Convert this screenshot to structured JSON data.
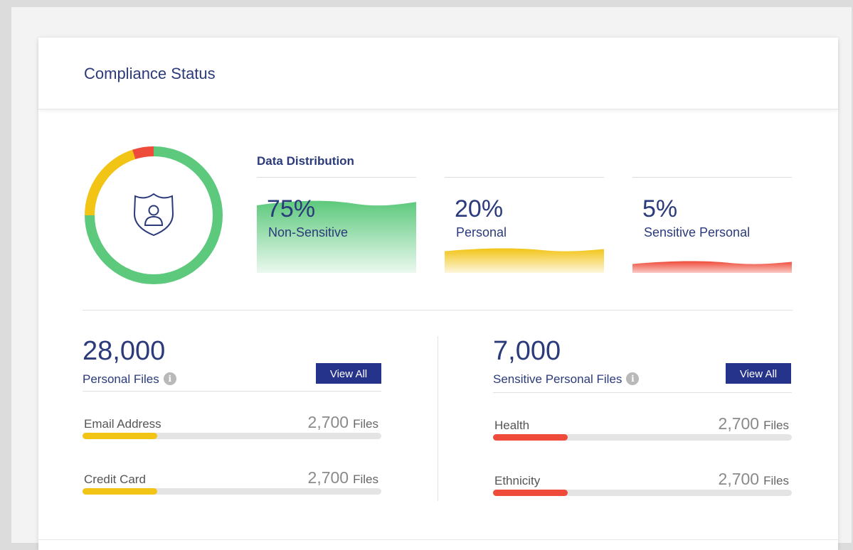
{
  "card": {
    "title": "Compliance Status"
  },
  "colors": {
    "green": "#5cc97c",
    "yellow": "#f2c416",
    "red": "#ef4b3a",
    "navy": "#2b3a7a",
    "button": "#26338a"
  },
  "donut": {
    "icon": "shield-user-icon",
    "segments": [
      {
        "name": "Non-Sensitive",
        "value": 75,
        "color": "#5cc97c"
      },
      {
        "name": "Personal",
        "value": 20,
        "color": "#f2c416"
      },
      {
        "name": "Sensitive Personal",
        "value": 5,
        "color": "#ef4b3a"
      }
    ]
  },
  "distribution": {
    "title": "Data Distribution",
    "items": [
      {
        "percent": "75%",
        "label": "Non-Sensitive",
        "value": 75,
        "color": "#5cc97c"
      },
      {
        "percent": "20%",
        "label": "Personal",
        "value": 20,
        "color": "#f2c416"
      },
      {
        "percent": "5%",
        "label": "Sensitive Personal",
        "value": 5,
        "color": "#ef4b3a"
      }
    ]
  },
  "personal": {
    "count": "28,000",
    "label": "Personal Files",
    "info_icon": "info-icon",
    "button": "View All",
    "rows": [
      {
        "label": "Email Address",
        "count": "2,700",
        "unit": "Files",
        "fraction": 0.25
      },
      {
        "label": "Credit Card",
        "count": "2,700",
        "unit": "Files",
        "fraction": 0.25
      }
    ]
  },
  "sensitive": {
    "count": "7,000",
    "label": "Sensitive Personal Files",
    "info_icon": "info-icon",
    "button": "View All",
    "rows": [
      {
        "label": "Health",
        "count": "2,700",
        "unit": "Files",
        "fraction": 0.25
      },
      {
        "label": "Ethnicity",
        "count": "2,700",
        "unit": "Files",
        "fraction": 0.25
      }
    ]
  },
  "info_glyph": "i"
}
